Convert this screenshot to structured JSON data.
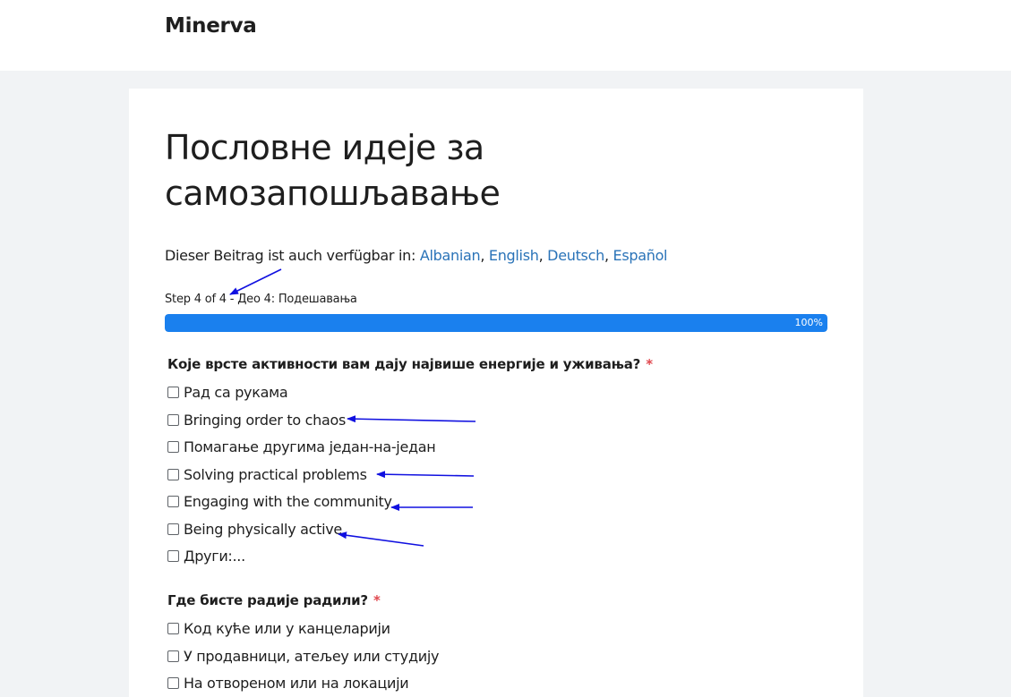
{
  "site": {
    "brand": "Minerva"
  },
  "post": {
    "title": "Пословне идеје за самозапошљавање",
    "translations": {
      "prefix": "Dieser Beitrag ist auch verfügbar in: ",
      "links": [
        "Albanian",
        "English",
        "Deutsch",
        "Español"
      ],
      "separator": ", "
    }
  },
  "progress": {
    "label": "Step 4 of 4 - Део 4: Подешавања",
    "percent_text": "100%",
    "value": 1.0,
    "color": "#1a80ee"
  },
  "questions": [
    {
      "label": "Које врсте активности вам дају највише енергије и уживања?",
      "required_mark": "*",
      "options": [
        "Рад са рукама",
        "Bringing order to chaos",
        "Помагање другима један-на-један",
        "Solving practical problems",
        "Engaging with the community",
        "Being physically active",
        "Други:..."
      ]
    },
    {
      "label": "Где бисте радије радили?",
      "required_mark": "*",
      "options": [
        "Код куће или у канцеларији",
        "У продавници, атељеу или студију",
        "На отвореном или на локацији"
      ]
    }
  ],
  "annotation_color": "#1010e0"
}
